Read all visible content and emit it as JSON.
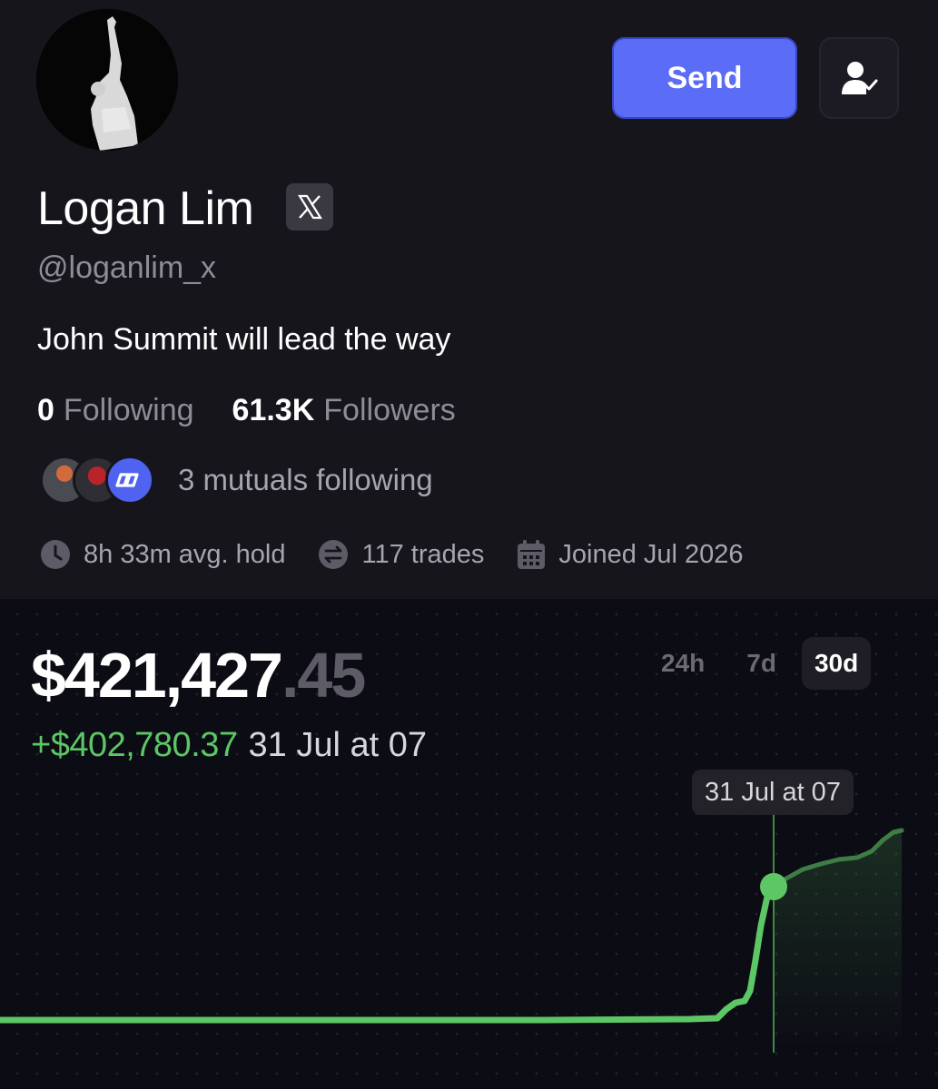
{
  "header": {
    "send_label": "Send"
  },
  "profile": {
    "name": "Logan Lim",
    "handle": "@loganlim_x",
    "bio": "John Summit will lead the way",
    "following_count": "0",
    "following_label": "Following",
    "followers_count": "61.3K",
    "followers_label": "Followers",
    "mutuals_text": "3 mutuals following",
    "avg_hold": "8h 33m avg. hold",
    "trades": "117 trades",
    "joined": "Joined Jul 2026"
  },
  "portfolio": {
    "balance_main": "$421,427",
    "balance_cents": ".45",
    "change_amount": "+$402,780.37",
    "change_date": "31 Jul at 07",
    "ranges": [
      "24h",
      "7d",
      "30d"
    ],
    "active_range": "30d",
    "tooltip": "31 Jul at 07"
  },
  "colors": {
    "accent": "#5b6cf7",
    "positive": "#5cc764",
    "background": "#0c0c14",
    "panel": "#16151c"
  },
  "icons": [
    "verified-follow-icon",
    "x-logo-icon",
    "clock-icon",
    "swap-icon",
    "calendar-icon"
  ]
}
